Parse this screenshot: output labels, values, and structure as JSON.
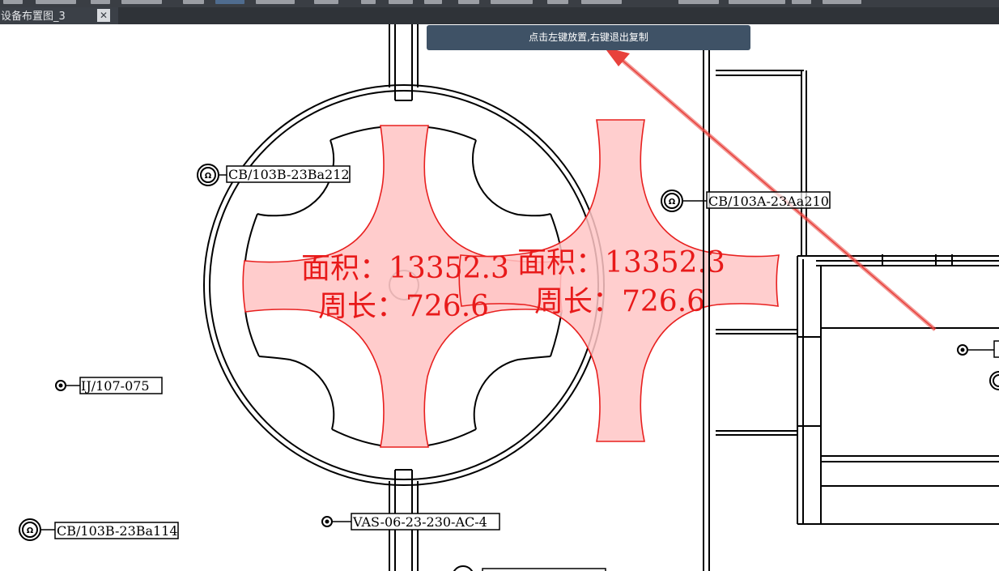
{
  "window": {
    "tab_title": "设备布置图_3",
    "close_glyph": "✕"
  },
  "tooltip": {
    "text": "点击左键放置,右键退出复制"
  },
  "measurements": [
    {
      "area": "面积：13352.3",
      "perimeter": "周长：726.6"
    },
    {
      "area": "面积：13352.3",
      "perimeter": "周长：726.6"
    }
  ],
  "tags": {
    "cb_212": "CB/103B-23Ba212",
    "cb_210": "CB/103A-23Aa210",
    "ij_075": "IJ/107-075",
    "cb_114": "CB/103B-23Ba114",
    "vas_ac4": "VAS-06-23-230-AC-4"
  },
  "colors": {
    "selection_fill": "#ffc6c6",
    "selection_stroke": "#e8201f",
    "measure_text": "#e81a1a",
    "arrow": "#e8413c",
    "tooltip_bg": "#3f5266",
    "toolbar_bg": "#3a3e44"
  }
}
